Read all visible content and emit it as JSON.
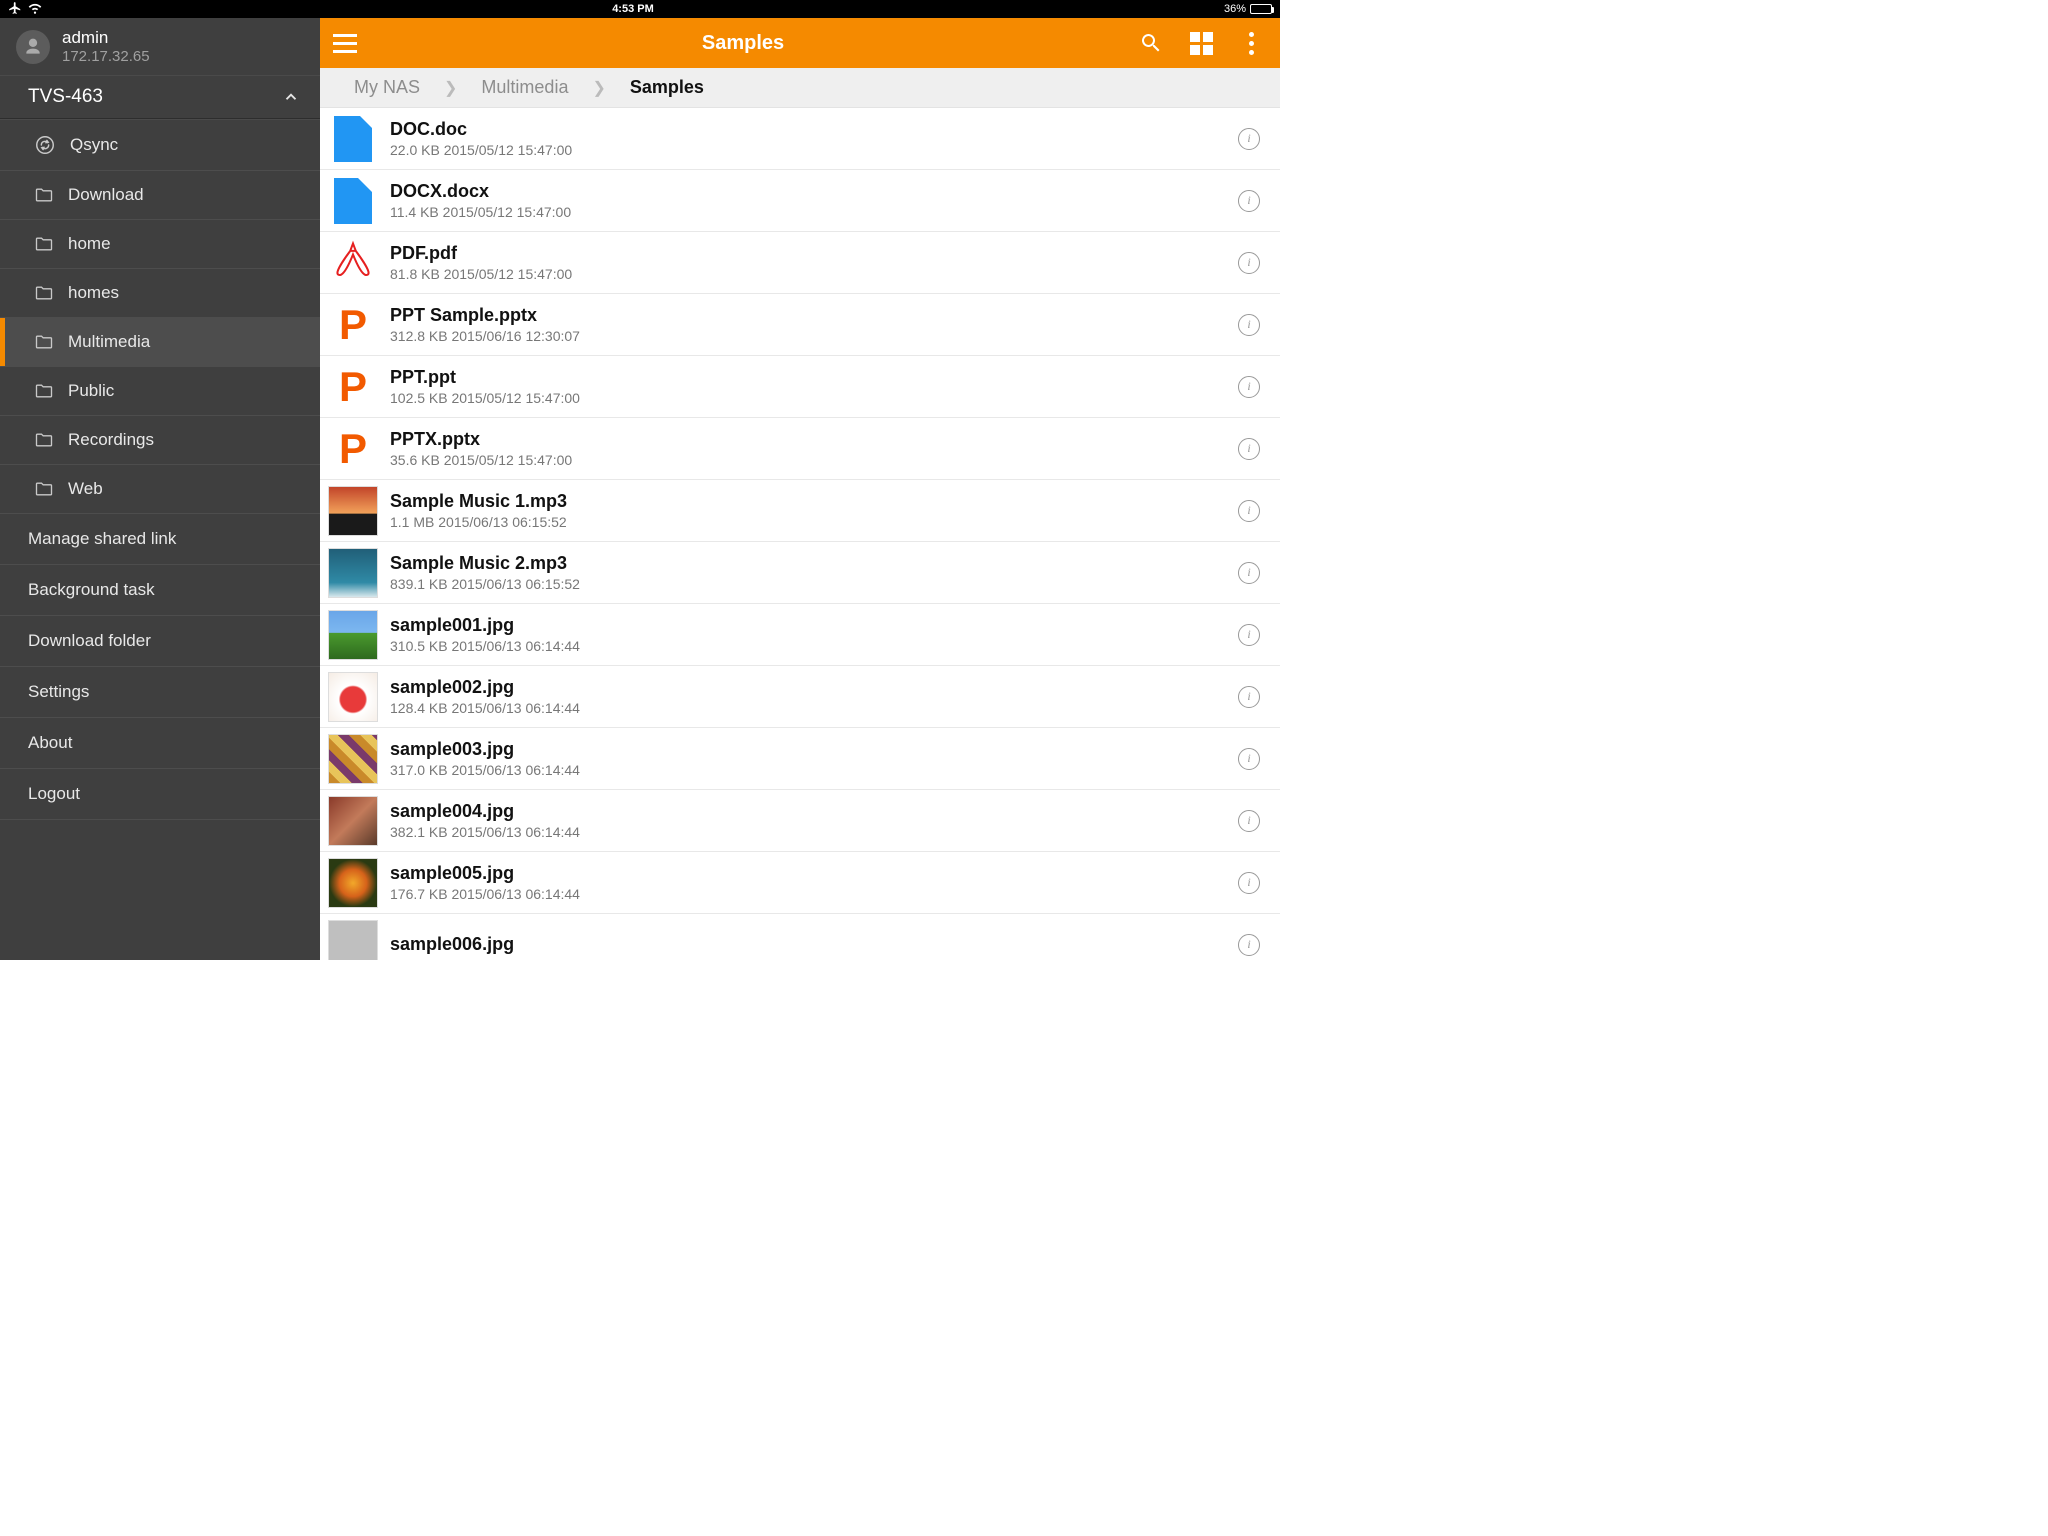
{
  "status": {
    "time": "4:53 PM",
    "battery": "36%",
    "battery_level": 36
  },
  "user": {
    "name": "admin",
    "address": "172.17.32.65"
  },
  "device": {
    "name": "TVS-463"
  },
  "folders": [
    {
      "label": "Qsync",
      "icon": "sync"
    },
    {
      "label": "Download",
      "icon": "folder"
    },
    {
      "label": "home",
      "icon": "folder"
    },
    {
      "label": "homes",
      "icon": "folder"
    },
    {
      "label": "Multimedia",
      "icon": "folder",
      "active": true
    },
    {
      "label": "Public",
      "icon": "folder"
    },
    {
      "label": "Recordings",
      "icon": "folder"
    },
    {
      "label": "Web",
      "icon": "folder"
    }
  ],
  "menu": [
    {
      "label": "Manage shared link"
    },
    {
      "label": "Background task"
    },
    {
      "label": "Download folder"
    },
    {
      "label": "Settings"
    },
    {
      "label": "About"
    },
    {
      "label": "Logout"
    }
  ],
  "title": "Samples",
  "breadcrumb": [
    {
      "label": "My NAS"
    },
    {
      "label": "Multimedia"
    },
    {
      "label": "Samples",
      "current": true
    }
  ],
  "files": [
    {
      "name": "DOC.doc",
      "size": "22.0 KB",
      "date": "2015/05/12 15:47:00",
      "type": "doc"
    },
    {
      "name": "DOCX.docx",
      "size": "11.4 KB",
      "date": "2015/05/12 15:47:00",
      "type": "docx"
    },
    {
      "name": "PDF.pdf",
      "size": "81.8 KB",
      "date": "2015/05/12 15:47:00",
      "type": "pdf"
    },
    {
      "name": "PPT Sample.pptx",
      "size": "312.8 KB",
      "date": "2015/06/16 12:30:07",
      "type": "ppt"
    },
    {
      "name": "PPT.ppt",
      "size": "102.5 KB",
      "date": "2015/05/12 15:47:00",
      "type": "ppt"
    },
    {
      "name": "PPTX.pptx",
      "size": "35.6 KB",
      "date": "2015/05/12 15:47:00",
      "type": "ppt"
    },
    {
      "name": "Sample Music 1.mp3",
      "size": "1.1 MB",
      "date": "2015/06/13 06:15:52",
      "type": "img",
      "thumb": "sunset"
    },
    {
      "name": "Sample Music 2.mp3",
      "size": "839.1 KB",
      "date": "2015/06/13 06:15:52",
      "type": "img",
      "thumb": "sea"
    },
    {
      "name": "sample001.jpg",
      "size": "310.5 KB",
      "date": "2015/06/13 06:14:44",
      "type": "img",
      "thumb": "field"
    },
    {
      "name": "sample002.jpg",
      "size": "128.4 KB",
      "date": "2015/06/13 06:14:44",
      "type": "img",
      "thumb": "drink"
    },
    {
      "name": "sample003.jpg",
      "size": "317.0 KB",
      "date": "2015/06/13 06:14:44",
      "type": "img",
      "thumb": "macarons"
    },
    {
      "name": "sample004.jpg",
      "size": "382.1 KB",
      "date": "2015/06/13 06:14:44",
      "type": "img",
      "thumb": "people"
    },
    {
      "name": "sample005.jpg",
      "size": "176.7 KB",
      "date": "2015/06/13 06:14:44",
      "type": "img",
      "thumb": "flower"
    },
    {
      "name": "sample006.jpg",
      "size": "",
      "date": "",
      "type": "img",
      "thumb": "gray"
    }
  ],
  "thumbs": {
    "sunset": "linear-gradient(to bottom,#c2452a 0%,#f2a25a 55%,#1a1a1a 56%,#1a1a1a 100%)",
    "sea": "linear-gradient(to bottom,#215f78 0%,#2f8aa6 70%,#d8e8ec 100%)",
    "field": "linear-gradient(to bottom,#6aa6e8 0%,#7cb7f0 45%,#4a9a2e 46%,#2e6a1e 100%)",
    "drink": "radial-gradient(circle at 50% 55%,#e83a3a 0%,#e83a3a 35%,#fff 40%,#f5ece4 100%)",
    "macarons": "repeating-linear-gradient(45deg,#c98a2a 0 8px,#e8c45a 8px 16px,#7a3a6a 16px 24px)",
    "people": "linear-gradient(135deg,#8a3a2a 0%,#c27a5a 50%,#5a3a2a 100%)",
    "flower": "radial-gradient(circle at 50% 50%,#f2a82a 0%,#d6621a 40%,#2a3a12 70%)",
    "gray": "linear-gradient(#bfbfbf,#bfbfbf)"
  }
}
